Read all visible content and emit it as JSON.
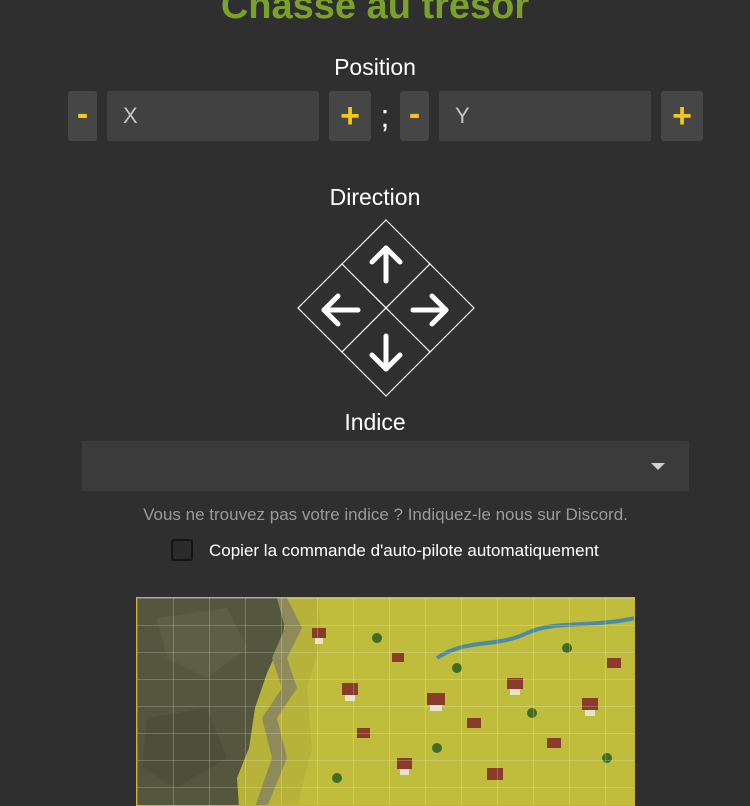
{
  "header": {
    "title": "Chasse au trésor"
  },
  "position": {
    "label": "Position",
    "minus_label": "-",
    "plus_label": "+",
    "separator": ";",
    "x_placeholder": "X",
    "y_placeholder": "Y"
  },
  "direction": {
    "label": "Direction",
    "icons": [
      "arrow-up-icon",
      "arrow-left-icon",
      "arrow-right-icon",
      "arrow-down-icon"
    ]
  },
  "indice": {
    "label": "Indice",
    "selected_value": "",
    "hint": "Vous ne trouvez pas votre indice ? Indiquez-le nous sur Discord.",
    "autopilot_label": "Copier la commande d'auto-pilote automatiquement",
    "autopilot_checked": false
  },
  "colors": {
    "background": "#2f2f2f",
    "title": "#7aa22a",
    "accent": "#f5c518",
    "button_bg": "#464646",
    "input_bg": "#414141"
  }
}
